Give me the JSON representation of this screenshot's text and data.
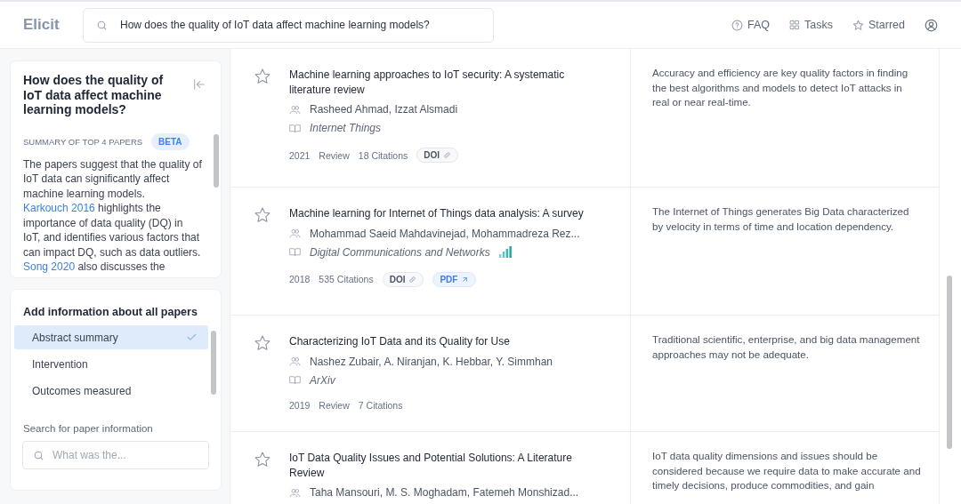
{
  "header": {
    "logo": "Elicit",
    "search": {
      "value": "How does the quality of IoT data affect machine learning models?"
    },
    "nav": [
      {
        "kind": "faq",
        "label": "FAQ"
      },
      {
        "kind": "tasks",
        "label": "Tasks"
      },
      {
        "kind": "starred",
        "label": "Starred"
      }
    ]
  },
  "summary_card": {
    "question": "How does the quality of IoT data affect machine learning models?",
    "heading": "SUMMARY OF TOP 4 PAPERS",
    "badge": "BETA",
    "text": [
      {
        "text": "The papers suggest that the quality of IoT data can significantly affect machine learning models. ",
        "link": false
      },
      {
        "text": "Karkouch 2016",
        "link": true
      },
      {
        "text": " highlights the importance of data quality (DQ) in IoT, and identifies various factors that can impact DQ, such as data outliers. ",
        "link": false
      },
      {
        "text": "Song 2020",
        "link": true
      },
      {
        "text": " also discusses the",
        "link": false
      }
    ]
  },
  "info_card": {
    "title": "Add information about all papers",
    "options": [
      {
        "label": "Abstract summary",
        "selected": true
      },
      {
        "label": "Intervention",
        "selected": false
      },
      {
        "label": "Outcomes measured",
        "selected": false
      }
    ],
    "search_label": "Search for paper information",
    "search": {
      "placeholder": "What was the..."
    }
  },
  "papers": [
    {
      "title": "Machine learning approaches to IoT security: A systematic literature review",
      "authors": "Rasheed Ahmad, Izzat Alsmadi",
      "journal": "Internet Things",
      "quality_badge": false,
      "year": "2021",
      "type": "Review",
      "citations": "18 Citations",
      "links": [
        {
          "kind": "doi",
          "label": "DOI"
        }
      ],
      "starred": false,
      "summary": "Accuracy and efficiency are key quality factors in finding the best algorithms and models to detect IoT attacks in real or near real-time."
    },
    {
      "title": "Machine learning for Internet of Things data analysis: A survey",
      "authors": "Mohammad Saeid Mahdavinejad, Mohammadreza Rez...",
      "journal": "Digital Communications and Networks",
      "quality_badge": true,
      "year": "2018",
      "citations": "535 Citations",
      "links": [
        {
          "kind": "doi",
          "label": "DOI"
        },
        {
          "kind": "pdf",
          "label": "PDF"
        }
      ],
      "starred": false,
      "summary": "The Internet of Things generates Big Data characterized by velocity in terms of time and location dependency."
    },
    {
      "title": "Characterizing IoT Data and its Quality for Use",
      "authors": "Nashez Zubair, A. Niranjan, K. Hebbar, Y. Simmhan",
      "journal": "ArXiv",
      "quality_badge": false,
      "year": "2019",
      "type": "Review",
      "citations": "7 Citations",
      "starred": false,
      "summary": "Traditional scientific, enterprise, and big data management approaches may not be adequate."
    },
    {
      "title": "IoT Data Quality Issues and Potential Solutions: A Literature Review",
      "authors": "Taha Mansouri, M. S. Moghadam, Fatemeh Monshizad...",
      "starred": false,
      "summary": "IoT data quality dimensions and issues should be considered because we require data to make accurate and timely decisions, produce commodities, and gain"
    }
  ]
}
